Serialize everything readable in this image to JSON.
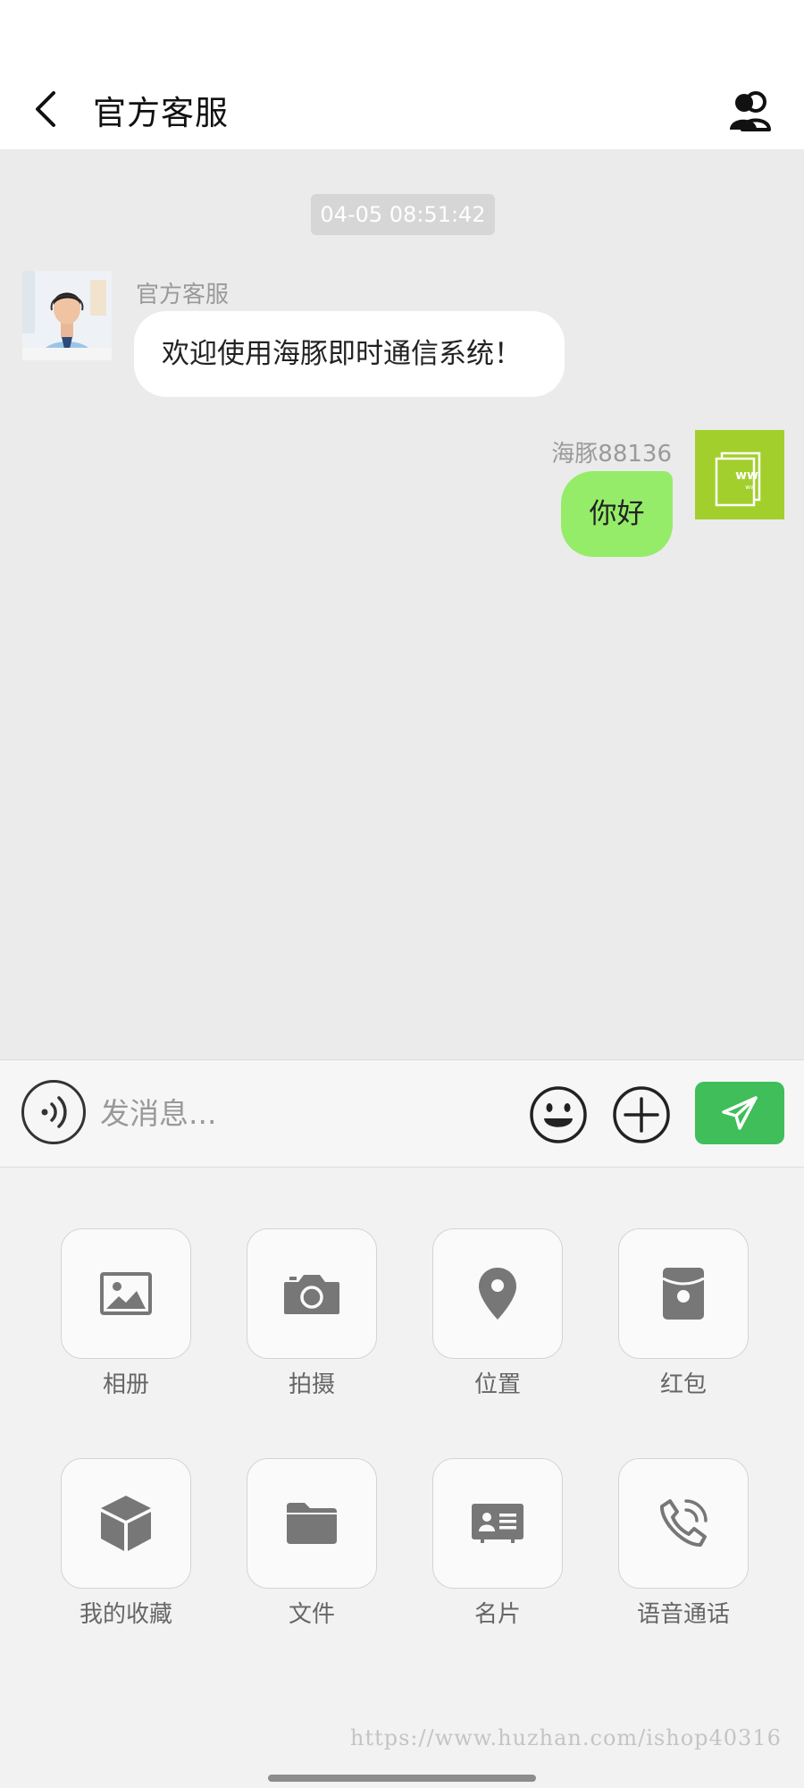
{
  "header": {
    "title": "官方客服"
  },
  "chat": {
    "timestamp": "04-05 08:51:42",
    "messages": [
      {
        "side": "left",
        "sender": "官方客服",
        "text": "欢迎使用海豚即时通信系统！"
      },
      {
        "side": "right",
        "sender": "海豚88136",
        "text": "你好"
      }
    ]
  },
  "input": {
    "placeholder": "发消息..."
  },
  "tools": [
    {
      "label": "相册",
      "icon": "image-icon"
    },
    {
      "label": "拍摄",
      "icon": "camera-icon"
    },
    {
      "label": "位置",
      "icon": "location-pin-icon"
    },
    {
      "label": "红包",
      "icon": "red-packet-icon"
    },
    {
      "label": "我的收藏",
      "icon": "cube-icon"
    },
    {
      "label": "文件",
      "icon": "folder-icon"
    },
    {
      "label": "名片",
      "icon": "contact-card-icon"
    },
    {
      "label": "语音通话",
      "icon": "phone-call-icon"
    }
  ],
  "watermark": "https://www.huzhan.com/ishop40316",
  "colors": {
    "send_button": "#3fbe5a",
    "own_bubble": "#95ec69",
    "chat_background": "#ebebeb",
    "avatar_right": "#a3cf2d"
  }
}
